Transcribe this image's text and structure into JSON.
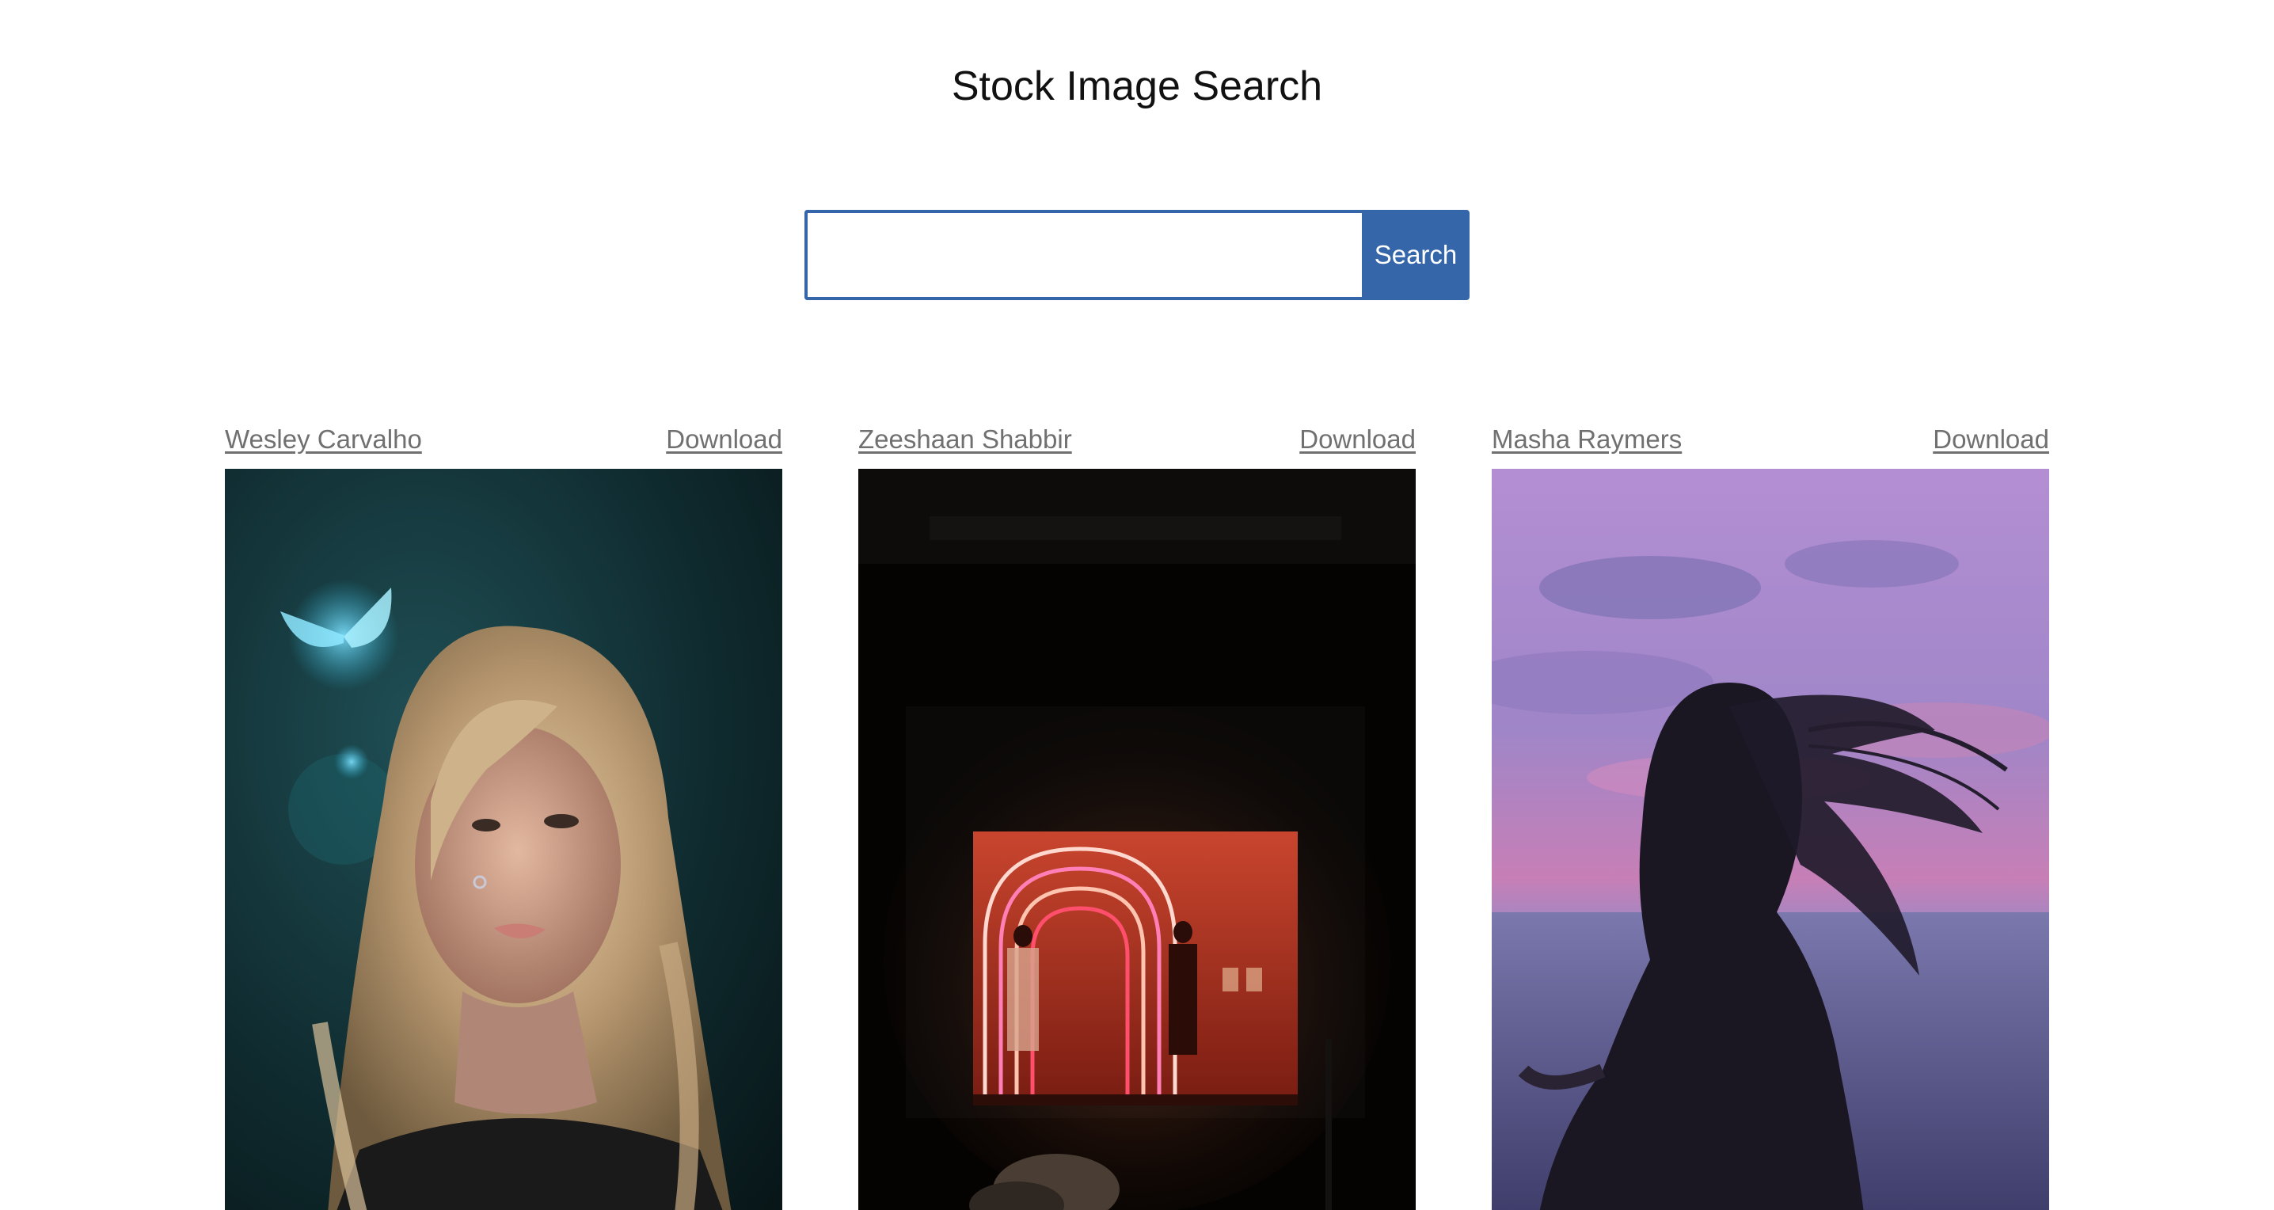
{
  "header": {
    "title": "Stock Image Search"
  },
  "search": {
    "value": "",
    "placeholder": "",
    "button_label": "Search"
  },
  "results": [
    {
      "author": "Wesley Carvalho",
      "download_label": "Download",
      "image_alt": "Woman with long wavy blonde hair and glowing blue butterflies"
    },
    {
      "author": "Zeeshaan Shabbir",
      "download_label": "Download",
      "image_alt": "Dark storefront with glowing neon arch signs in the window"
    },
    {
      "author": "Masha Raymers",
      "download_label": "Download",
      "image_alt": "Silhouette of woman with windblown hair against a purple sunset sky over the sea"
    }
  ],
  "colors": {
    "accent": "#3466a9",
    "link": "#707070",
    "title": "#111111"
  }
}
